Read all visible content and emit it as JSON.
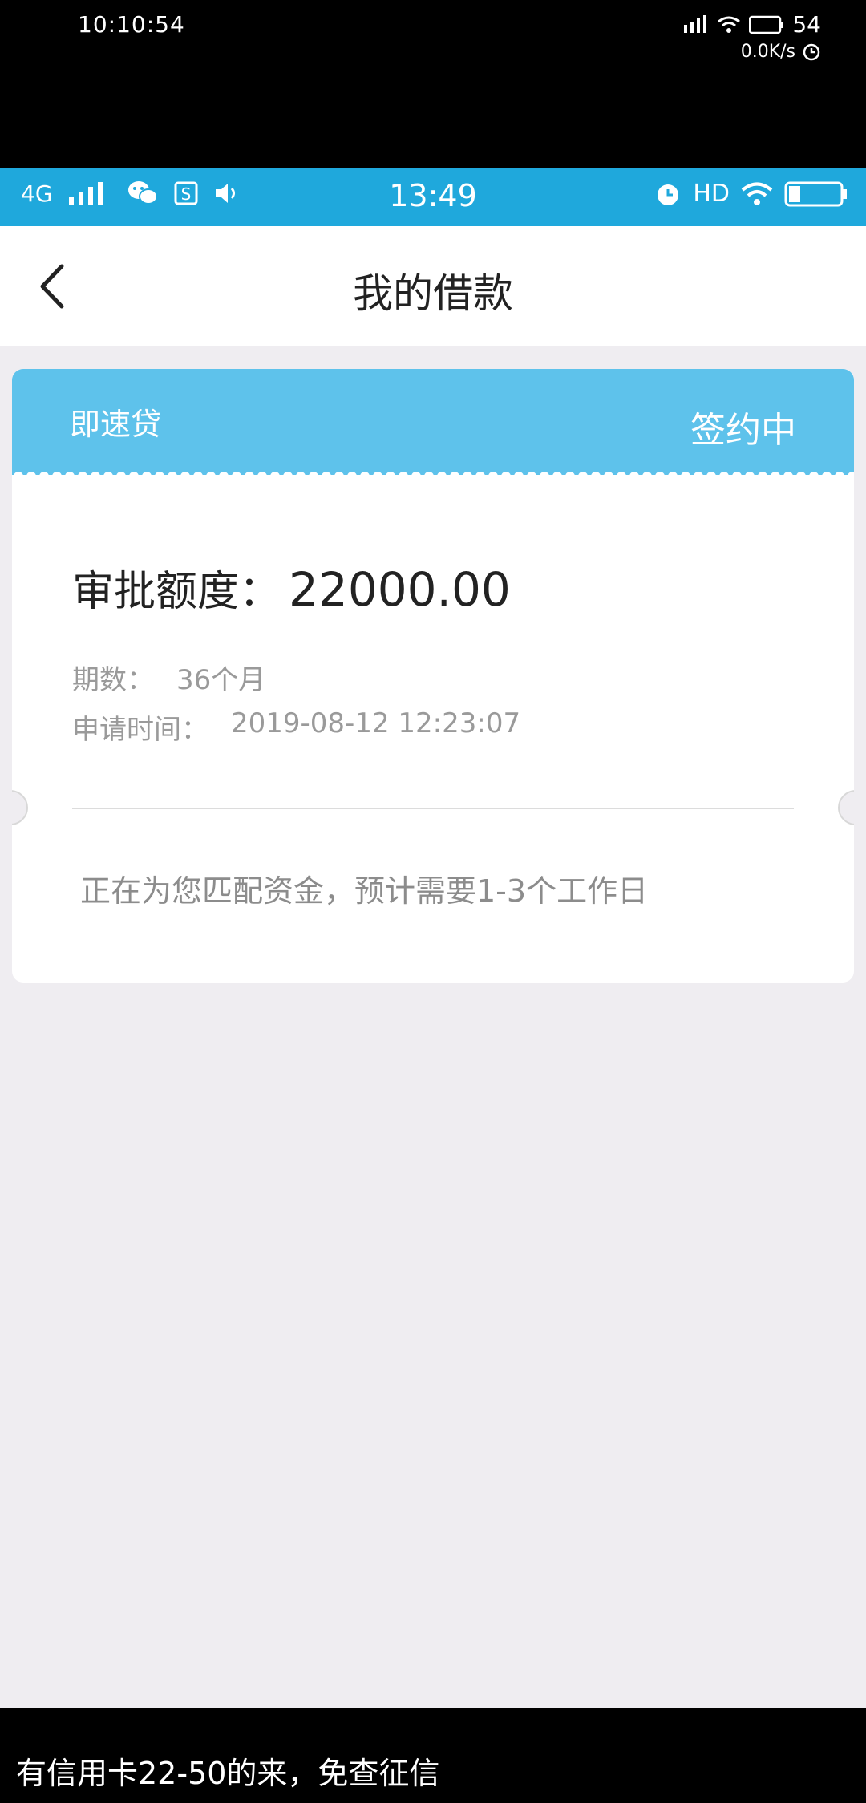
{
  "outer_status": {
    "time": "10:10:54",
    "battery": "54",
    "net_speed": "0.0K/s"
  },
  "inner_status": {
    "network": "4G",
    "time": "13:49",
    "hd": "HD",
    "icons": [
      "signal-icon",
      "wechat-icon",
      "s-app-icon",
      "volume-icon",
      "alarm-icon",
      "wifi-icon",
      "battery-icon"
    ]
  },
  "nav": {
    "title": "我的借款"
  },
  "loan": {
    "product": "即速贷",
    "status": "签约中",
    "amount_label": "审批额度：",
    "amount_value": "22000.00",
    "term_label": "期数：",
    "term_value": "36个月",
    "time_label": "申请时间：",
    "time_value": "2019-08-12 12:23:07",
    "note": "正在为您匹配资金，预计需要1-3个工作日"
  },
  "caption": "有信用卡22-50的来，免查征信",
  "colors": {
    "status_bar": "#1fa8dc",
    "card_header": "#5ec2eb",
    "background": "#efedf1"
  }
}
